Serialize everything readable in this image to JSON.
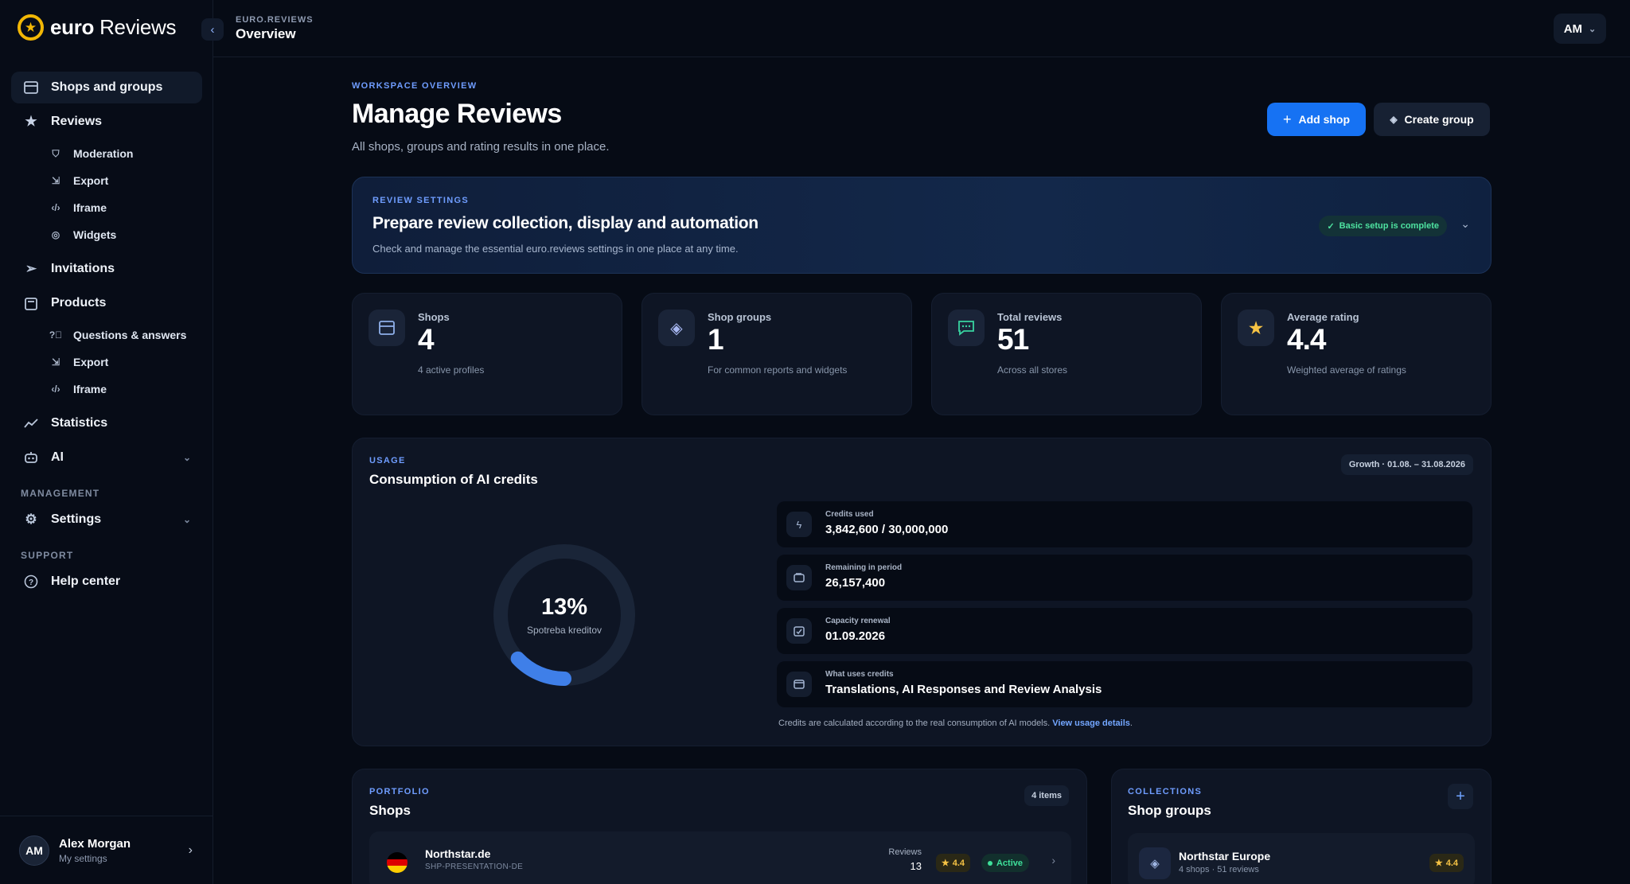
{
  "brand": {
    "name_bold": "euro",
    "name_light": " Reviews"
  },
  "sidebar": {
    "items": [
      {
        "label": "Shops and groups",
        "icon": "store-icon"
      },
      {
        "label": "Reviews",
        "icon": "star-icon"
      },
      {
        "label": "Moderation",
        "icon": "shield-icon"
      },
      {
        "label": "Export",
        "icon": "export-icon"
      },
      {
        "label": "Iframe",
        "icon": "code-icon"
      },
      {
        "label": "Widgets",
        "icon": "widgets-icon"
      },
      {
        "label": "Invitations",
        "icon": "send-icon"
      },
      {
        "label": "Products",
        "icon": "box-icon"
      },
      {
        "label": "Questions & answers",
        "icon": "question-icon"
      },
      {
        "label": "Export",
        "icon": "export-icon"
      },
      {
        "label": "Iframe",
        "icon": "code-icon"
      },
      {
        "label": "Statistics",
        "icon": "chart-icon"
      },
      {
        "label": "AI",
        "icon": "robot-icon"
      }
    ],
    "management_label": "MANAGEMENT",
    "settings_label": "Settings",
    "support_label": "SUPPORT",
    "help_label": "Help center",
    "user": {
      "initials": "AM",
      "name": "Alex Morgan",
      "sub": "My settings"
    }
  },
  "topbar": {
    "crumb": "EURO.REVIEWS",
    "title": "Overview",
    "avatar": "AM"
  },
  "page": {
    "eyebrow": "WORKSPACE OVERVIEW",
    "title": "Manage Reviews",
    "subtitle": "All shops, groups and rating results in one place.",
    "add_shop": "Add shop",
    "create_group": "Create group"
  },
  "review_settings": {
    "eyebrow": "REVIEW SETTINGS",
    "title": "Prepare review collection, display and automation",
    "subtitle": "Check and manage the essential euro.reviews settings in one place at any time.",
    "badge": "Basic setup is complete"
  },
  "stats": [
    {
      "label": "Shops",
      "value": "4",
      "desc": "4 active profiles"
    },
    {
      "label": "Shop groups",
      "value": "1",
      "desc": "For common reports and widgets"
    },
    {
      "label": "Total reviews",
      "value": "51",
      "desc": "Across all stores"
    },
    {
      "label": "Average rating",
      "value": "4.4",
      "desc": "Weighted average of ratings"
    }
  ],
  "usage": {
    "eyebrow": "USAGE",
    "title": "Consumption of AI credits",
    "period": "Growth · 01.08. – 31.08.2026",
    "percent": 13,
    "percent_label": "13%",
    "donut_label": "Spotreba kreditov",
    "rows": [
      {
        "label": "Credits used",
        "value": "3,842,600 / 30,000,000"
      },
      {
        "label": "Remaining in period",
        "value": "26,157,400"
      },
      {
        "label": "Capacity renewal",
        "value": "01.09.2026"
      },
      {
        "label": "What uses credits",
        "value": "Translations, AI Responses and Review Analysis"
      }
    ],
    "note": "Credits are calculated according to the real consumption of AI models. ",
    "note_link": "View usage details",
    "note_end": "."
  },
  "shops": {
    "eyebrow": "PORTFOLIO",
    "title": "Shops",
    "count": "4 items",
    "rows": [
      {
        "name": "Northstar.de",
        "code": "SHP-PRESENTATION-DE",
        "reviews_label": "Reviews",
        "reviews": "13",
        "rating": "4.4",
        "status": "Active"
      }
    ]
  },
  "groups": {
    "eyebrow": "COLLECTIONS",
    "title": "Shop groups",
    "rows": [
      {
        "name": "Northstar Europe",
        "meta": "4 shops · 51 reviews",
        "rating": "4.4"
      }
    ]
  },
  "colors": {
    "accent": "#1672f3",
    "star": "#f6c344",
    "success": "#3ee09a",
    "bg": "#060b15"
  }
}
